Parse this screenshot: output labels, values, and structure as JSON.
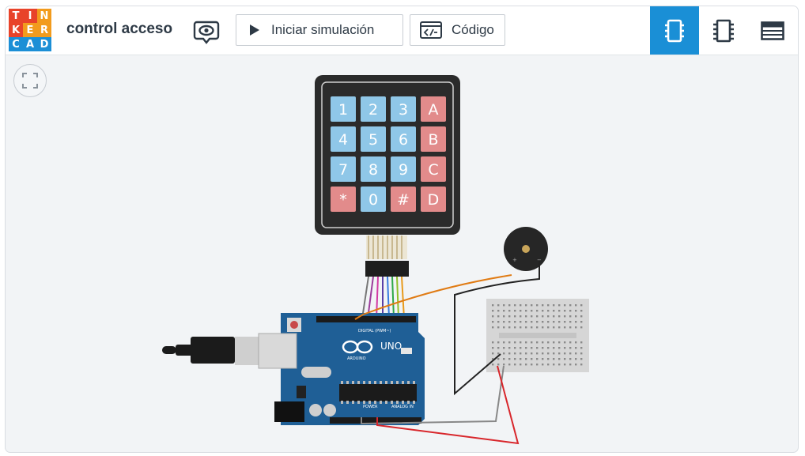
{
  "logo": {
    "letters": [
      "T",
      "I",
      "N",
      "K",
      "E",
      "R",
      "C",
      "A",
      "D"
    ],
    "colors": [
      "#e8432a",
      "#e8432a",
      "#f29b1d",
      "#e8432a",
      "#f29b1d",
      "#f29b1d",
      "#1c8fd6",
      "#1c8fd6",
      "#1c8fd6"
    ]
  },
  "header": {
    "project_title": "control acceso",
    "simulate_label": "Iniciar simulación",
    "code_label": "Código"
  },
  "view_buttons": [
    {
      "name": "schematic-view",
      "icon": "chip-icon",
      "active": true
    },
    {
      "name": "component-view",
      "icon": "ic-icon",
      "active": false
    },
    {
      "name": "component-list",
      "icon": "list-icon",
      "active": false
    }
  ],
  "keypad": {
    "keys": [
      "1",
      "2",
      "3",
      "A",
      "4",
      "5",
      "6",
      "B",
      "7",
      "8",
      "9",
      "C",
      "*",
      "0",
      "#",
      "D"
    ]
  },
  "arduino": {
    "brand": "ARDUINO",
    "model": "UNO",
    "digital_label": "DIGITAL (PWM~)",
    "power_label": "POWER",
    "analog_label": "ANALOG IN"
  },
  "colors": {
    "accent": "#1a8fd6",
    "board": "#1f5f96",
    "wire_orange": "#e07b14",
    "wire_red": "#d8262b"
  }
}
